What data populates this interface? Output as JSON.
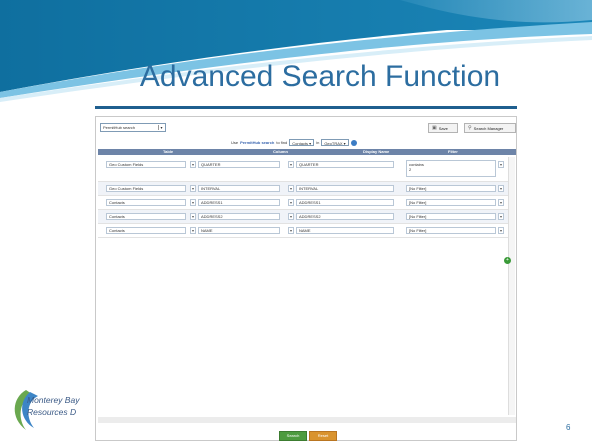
{
  "slide": {
    "title": "Advanced Search Function",
    "logo_line1": "Monterey Bay",
    "logo_line2": "Resources D",
    "page_number": "6"
  },
  "toolbar": {
    "search_select_value": "PermitHub search",
    "save_label": "Save",
    "search_manager_label": "Search Manager"
  },
  "query_line": {
    "prefix": "Use",
    "search_name": "PermitHub search",
    "middle": "to find",
    "find_value": "Contacts",
    "in_label": "in",
    "in_value": "GeoTRAX"
  },
  "table": {
    "headers": [
      "Table",
      "Column",
      "Display Name",
      "Filter"
    ],
    "rows": [
      {
        "table": "Geo Custom Fields",
        "column": "QUARTER",
        "display": "QUARTER",
        "filter_line1": "contains",
        "filter_line2": "2"
      },
      {
        "table": "Geo Custom Fields",
        "column": "INTERVAL",
        "display": "INTERVAL",
        "filter_line1": "[No Filter]"
      },
      {
        "table": "Contacts",
        "column": "ADDRESS1",
        "display": "ADDRESS1",
        "filter_line1": "[No Filter]"
      },
      {
        "table": "Contacts",
        "column": "ADDRESS2",
        "display": "ADDRESS2",
        "filter_line1": "[No Filter]"
      },
      {
        "table": "Contacts",
        "column": "NAME",
        "display": "NAME",
        "filter_line1": "[No Filter]"
      }
    ]
  },
  "footer": {
    "search_label": "Search",
    "reset_label": "Reset"
  }
}
